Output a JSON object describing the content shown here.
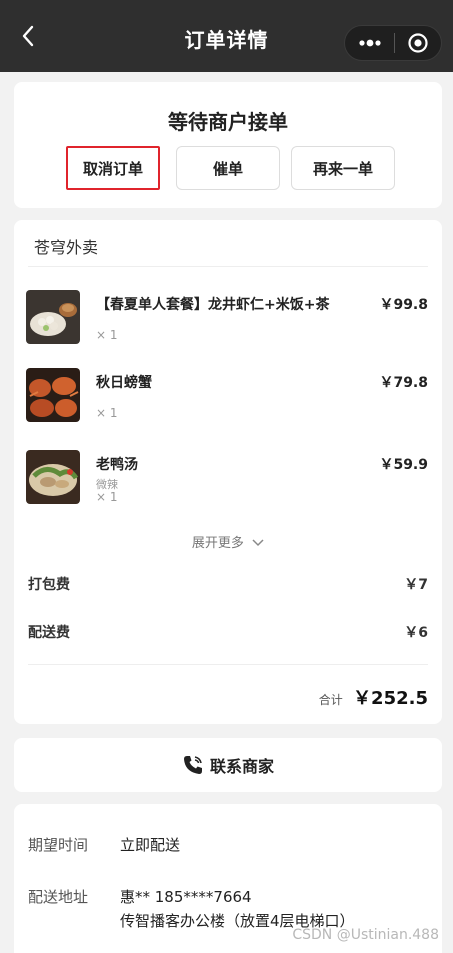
{
  "navbar": {
    "title": "订单详情",
    "back_icon": "chevron-left-icon",
    "more_icon": "more-dots-icon",
    "close_icon": "target-circle-icon"
  },
  "status": {
    "text": "等待商户接单",
    "buttons": {
      "cancel": "取消订单",
      "urge": "催单",
      "reorder": "再来一单"
    }
  },
  "order": {
    "shop_name": "苍穹外卖",
    "items": [
      {
        "name": "【春夏单人套餐】龙井虾仁+米饭+茶",
        "spec": "",
        "qty": "× 1",
        "price": "￥99.8"
      },
      {
        "name": "秋日螃蟹",
        "spec": "",
        "qty": "× 1",
        "price": "￥79.8"
      },
      {
        "name": "老鸭汤",
        "spec": "微辣",
        "qty": "× 1",
        "price": "￥59.9"
      }
    ],
    "expand_label": "展开更多",
    "fees": [
      {
        "label": "打包费",
        "value": "￥7"
      },
      {
        "label": "配送费",
        "value": "￥6"
      }
    ],
    "total_label": "合计",
    "total_value": "￥252.5"
  },
  "contact": {
    "label": "联系商家",
    "icon": "phone-icon"
  },
  "delivery": {
    "expected_time_label": "期望时间",
    "expected_time_value": "立即配送",
    "address_label": "配送地址",
    "address_name_phone": "惠** 185****7664",
    "address_detail": "传智播客办公楼（放置4层电梯口）"
  },
  "watermark": "CSDN @Ustinian.488",
  "colors": {
    "navbar": "#2f2f2f",
    "highlight_border": "#e0242c",
    "background": "#f2f2f2"
  }
}
